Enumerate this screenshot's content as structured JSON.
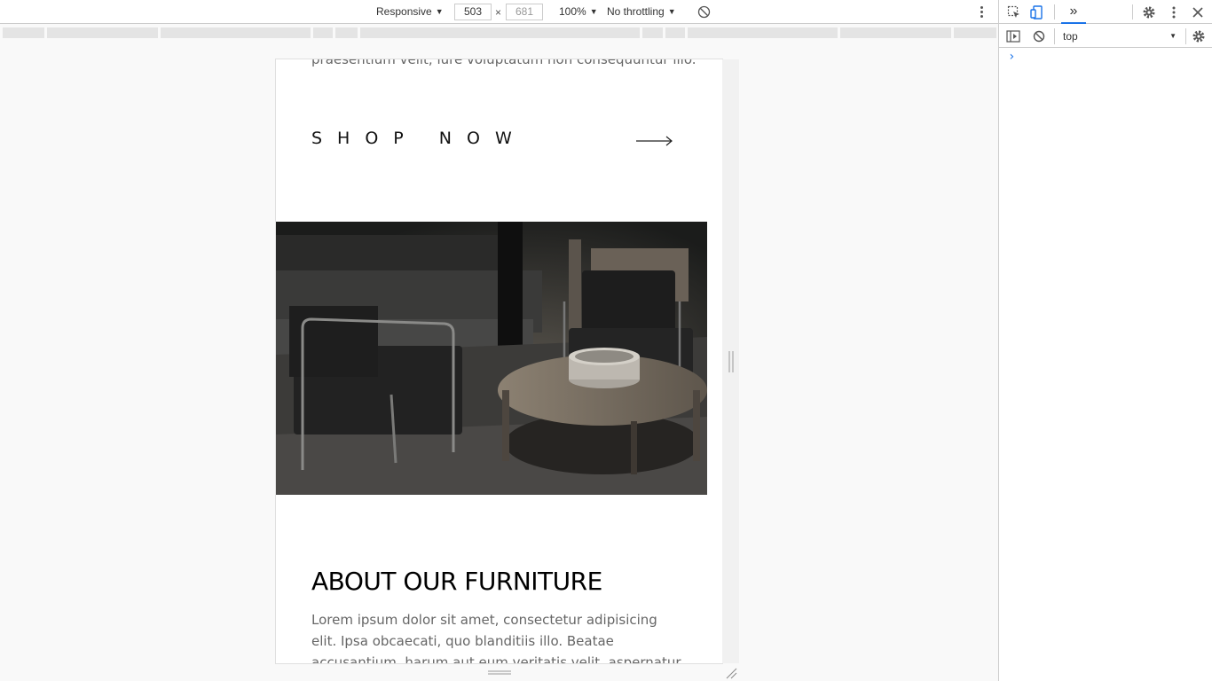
{
  "toolbar": {
    "device": "Responsive",
    "width": "503",
    "height": "681",
    "separator": "×",
    "zoom": "100%",
    "throttling": "No throttling"
  },
  "page": {
    "partial_text": "praesentium velit, iure voluptatum non consequuntur illo.",
    "shop_now": "SHOP NOW",
    "about_title": "ABOUT OUR FURNITURE",
    "about_body": "Lorem ipsum dolor sit amet, consectetur adipisicing elit. Ipsa obcaecati, quo blanditiis illo. Beatae accusantium, harum aut eum veritatis velit, aspernatur iste cupiditate"
  },
  "devtools": {
    "more_tabs": "»",
    "context": "top",
    "prompt": "›"
  },
  "colors": {
    "accent": "#1a73e8",
    "hero_dark": "#1c1d1c"
  }
}
